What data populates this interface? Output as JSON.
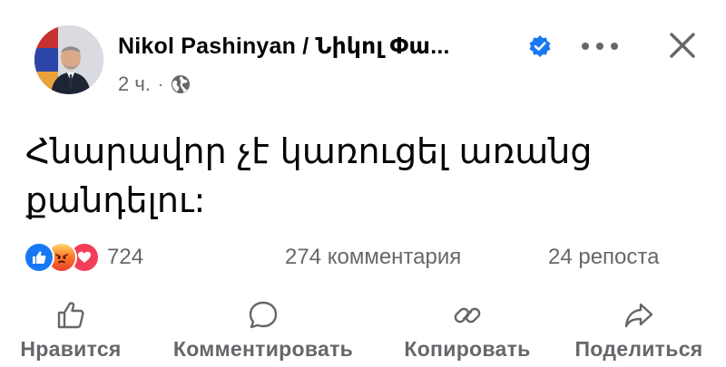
{
  "post": {
    "author_name": "Nikol Pashinyan / Նիկոլ Փա...",
    "timestamp": "2 ч.",
    "separator": "·",
    "audience_icon": "globe-icon",
    "verified_icon": "verified-badge-icon",
    "text": "Հնարավոր չէ կառուցել առանց քանդելու:"
  },
  "stats": {
    "reactions": [
      "like-reaction-icon",
      "angry-reaction-icon",
      "love-reaction-icon"
    ],
    "reaction_count": "724",
    "comments": "274 комментария",
    "shares": "24 репоста"
  },
  "actions": {
    "like": "Нравится",
    "comment": "Комментировать",
    "copy": "Копировать",
    "share": "Поделиться"
  },
  "colors": {
    "accent_blue": "#1877f2",
    "secondary_text": "#65676b",
    "love_red": "#f33e58"
  }
}
